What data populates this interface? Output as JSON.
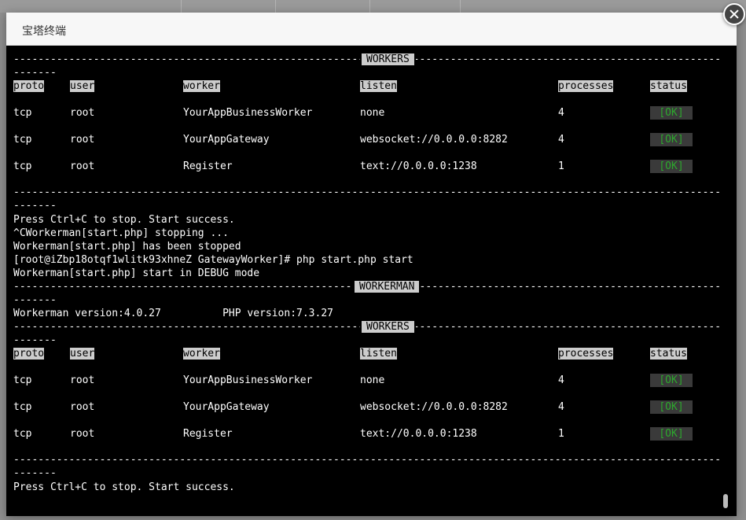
{
  "dialog": {
    "title": "宝塔终端"
  },
  "terminal": {
    "workers_label": "WORKERS",
    "workerman_label": "WORKERMAN",
    "headers": [
      "proto",
      "user",
      "worker",
      "listen",
      "processes",
      "status"
    ],
    "table1": [
      [
        "tcp",
        "root",
        "YourAppBusinessWorker",
        "none",
        "4",
        "[OK]"
      ],
      [
        "tcp",
        "root",
        "YourAppGateway",
        "websocket://0.0.0.0:8282",
        "4",
        "[OK]"
      ],
      [
        "tcp",
        "root",
        "Register",
        "text://0.0.0.0:1238",
        "1",
        "[OK]"
      ]
    ],
    "log": [
      "Press Ctrl+C to stop. Start success.",
      "^CWorkerman[start.php] stopping ...",
      "Workerman[start.php] has been stopped",
      "[root@iZbp18otqf1wlitk93xhneZ GatewayWorker]# php start.php start",
      "Workerman[start.php] start in DEBUG mode"
    ],
    "version_line": "Workerman version:4.0.27          PHP version:7.3.27",
    "table2": [
      [
        "tcp",
        "root",
        "YourAppBusinessWorker",
        "none",
        "4",
        "[OK]"
      ],
      [
        "tcp",
        "root",
        "YourAppGateway",
        "websocket://0.0.0.0:8282",
        "4",
        "[OK]"
      ],
      [
        "tcp",
        "root",
        "Register",
        "text://0.0.0.0:1238",
        "1",
        "[OK]"
      ]
    ],
    "final_line": "Press Ctrl+C to stop. Start success.",
    "rule_tail": "-------"
  }
}
